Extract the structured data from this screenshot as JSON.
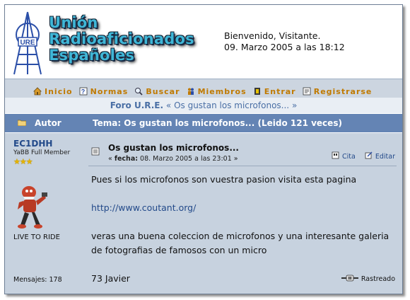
{
  "header": {
    "brand_lines": [
      "Unión",
      "Radioaficionados",
      "Españoles"
    ],
    "logo_text": "URE",
    "welcome": "Bienvenido, Visitante.",
    "datetime": "09. Marzo 2005 a las 18:12"
  },
  "menu": [
    {
      "label": "Inicio",
      "icon": "home-icon"
    },
    {
      "label": "Normas",
      "icon": "help-icon"
    },
    {
      "label": "Buscar",
      "icon": "search-icon"
    },
    {
      "label": "Miembros",
      "icon": "members-icon"
    },
    {
      "label": "Entrar",
      "icon": "login-icon"
    },
    {
      "label": "Registrarse",
      "icon": "register-icon"
    }
  ],
  "breadcrumb": {
    "forum": "Foro U.R.E.",
    "separator": "«",
    "topic": "Os gustan los microfonos...",
    "end": "»"
  },
  "category_bar": {
    "author_label": "Autor",
    "topic_label": "Tema: Os gustan los microfonos...  (Leido 121 veces)"
  },
  "post": {
    "poster_name": "EC1DHH",
    "poster_rank": "YaBB Full Member",
    "stars": "★★★",
    "motto": "LIVE TO RIDE",
    "posts_count": "Mensajes: 178",
    "subject": "Os gustan los microfonos...",
    "meta_prefix": "« ",
    "meta_label": "fecha:",
    "meta_value": " 08. Marzo 2005 a las 23:01 »",
    "quote_label": "Cita",
    "edit_label": "Editar",
    "body_lines": [
      "Pues si los microfonos son vuestra pasion visita esta pagina",
      "http://www.coutant.org/",
      "veras una buena coleccion de microfonos y una interesante galeria de fotografias de famosos con un micro",
      "73 Javier"
    ],
    "tracked_label": "Rastreado"
  },
  "colors": {
    "accent_orange": "#c07a00",
    "category_blue": "#6484b4",
    "post_bg": "#c7d2df",
    "link_blue": "#234a8a"
  }
}
